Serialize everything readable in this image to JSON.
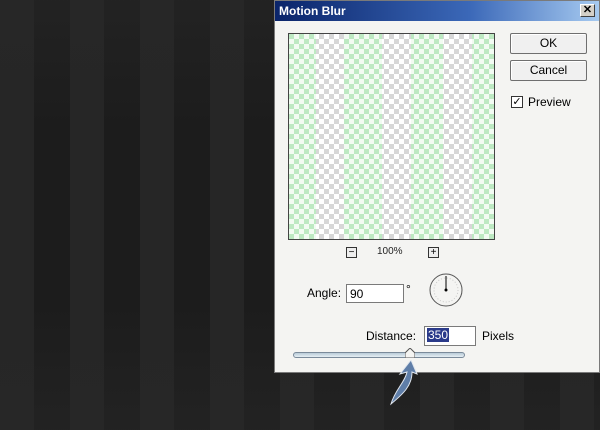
{
  "dialog": {
    "title": "Motion Blur",
    "close_glyph": "✕",
    "ok_label": "OK",
    "cancel_label": "Cancel",
    "preview_label": "Preview",
    "preview_checked": true,
    "check_glyph": "✓",
    "zoom_out_glyph": "−",
    "zoom_in_glyph": "+",
    "zoom_level": "100%",
    "angle_label": "Angle:",
    "angle_value": "90",
    "angle_unit": "°",
    "distance_label": "Distance:",
    "distance_value": "350",
    "distance_unit": "Pixels",
    "distance_slider_fraction": 0.68
  },
  "colors": {
    "title_bar": "#0a246a",
    "checker_green": "#c3ecc7",
    "checker_gray": "#d7d7d7",
    "selection": "#2a3a8a",
    "arrow": "#5f7ea8"
  },
  "icons": {
    "close": "close-icon",
    "zoom_out": "zoom-out-icon",
    "zoom_in": "zoom-in-icon",
    "angle_dial": "angle-dial-icon",
    "pointer_arrow": "curved-arrow-icon"
  }
}
